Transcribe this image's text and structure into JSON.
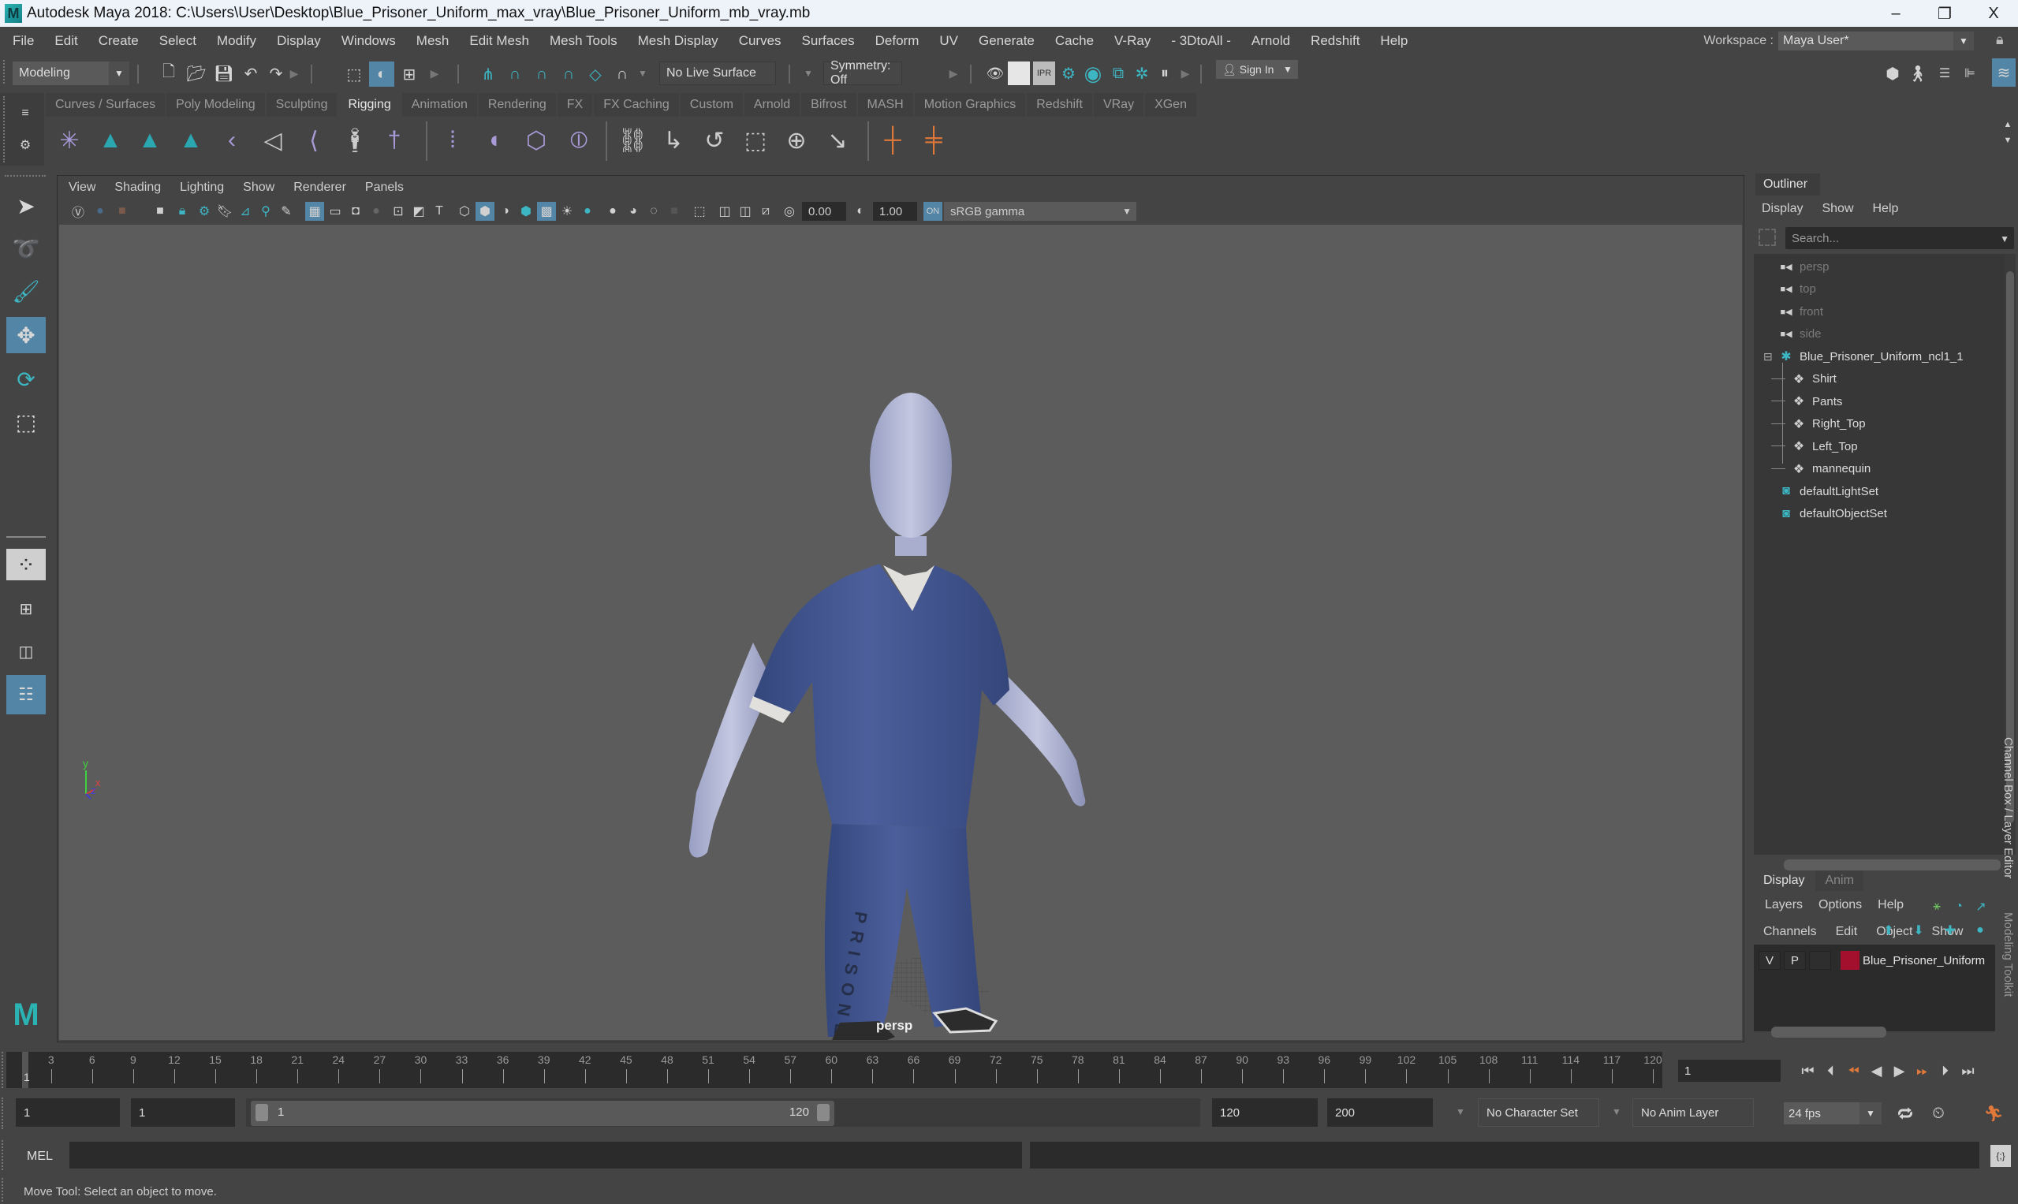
{
  "window": {
    "title": "Autodesk Maya 2018: C:\\Users\\User\\Desktop\\Blue_Prisoner_Uniform_max_vray\\Blue_Prisoner_Uniform_mb_vray.mb",
    "logo_letter": "M",
    "minimize": "–",
    "maximize": "❐",
    "close": "X"
  },
  "menubar": {
    "items": [
      "File",
      "Edit",
      "Create",
      "Select",
      "Modify",
      "Display",
      "Windows",
      "Mesh",
      "Edit Mesh",
      "Mesh Tools",
      "Mesh Display",
      "Curves",
      "Surfaces",
      "Deform",
      "UV",
      "Generate",
      "Cache",
      "V-Ray",
      "- 3DtoAll -",
      "Arnold",
      "Redshift",
      "Help"
    ],
    "workspace_label": "Workspace :",
    "workspace_value": "Maya User*"
  },
  "statusline": {
    "menuset": "Modeling",
    "live_surface": "No Live Surface",
    "symmetry": "Symmetry: Off",
    "sign_in": "Sign In",
    "icons": [
      "new-scene-icon",
      "open-scene-icon",
      "save-scene-icon",
      "undo-icon",
      "redo-icon",
      "select-hierarchy-icon",
      "select-object-icon",
      "select-component-icon",
      "snap-grid-icon",
      "snap-curve-icon",
      "snap-point-icon",
      "snap-view-plane-icon",
      "snap-live-icon",
      "snap-make-live-icon",
      "render-view-icon",
      "render-frame-icon",
      "ipr-render-icon",
      "render-settings-icon",
      "hypershade-icon",
      "render-setup-icon",
      "light-editor-icon",
      "pause-icon"
    ]
  },
  "shelf": {
    "tabs": [
      "Curves / Surfaces",
      "Poly Modeling",
      "Sculpting",
      "Rigging",
      "Animation",
      "Rendering",
      "FX",
      "FX Caching",
      "Custom",
      "Arnold",
      "Bifrost",
      "MASH",
      "Motion Graphics",
      "Redshift",
      "VRay",
      "XGen"
    ],
    "active_tab": "Rigging",
    "icons": [
      "joint-tool-icon",
      "quick-rig-icon",
      "hik-character-icon",
      "hik-skeleton-icon",
      "ik-handle-icon",
      "ik-spline-icon",
      "create-curve-warp-icon",
      "humanik-icon",
      "humanik-definition-icon",
      "bind-skin-icon",
      "paint-weights-icon",
      "lattice-icon",
      "cluster-icon",
      "parent-constraint-icon",
      "point-constraint-icon",
      "orient-constraint-icon",
      "scale-constraint-icon",
      "aim-constraint-icon",
      "pole-vector-constraint-icon",
      "locator-icon",
      "locator-constraint-icon"
    ]
  },
  "toolbox": {
    "tools": [
      "select-tool-icon",
      "lasso-tool-icon",
      "paint-select-tool-icon",
      "move-tool-icon",
      "rotate-tool-icon",
      "scale-tool-icon"
    ],
    "active_tool": "move-tool-icon",
    "layouts": [
      "single-perspective-layout-icon",
      "four-view-layout-icon",
      "two-view-layout-icon",
      "outliner-persp-layout-icon"
    ]
  },
  "viewport": {
    "menu": [
      "View",
      "Shading",
      "Lighting",
      "Show",
      "Renderer",
      "Panels"
    ],
    "exposure": "0.00",
    "gamma": "1.00",
    "color_space": "sRGB gamma",
    "camera_label": "persp",
    "pants_text": "PRISONER",
    "axis": {
      "y": "y",
      "x": "x",
      "z": "z"
    }
  },
  "outliner": {
    "tab": "Outliner",
    "menu": [
      "Display",
      "Show",
      "Help"
    ],
    "search_placeholder": "Search...",
    "items": [
      {
        "label": "persp",
        "type": "camera",
        "indent": 1
      },
      {
        "label": "top",
        "type": "camera",
        "indent": 1
      },
      {
        "label": "front",
        "type": "camera",
        "indent": 1
      },
      {
        "label": "side",
        "type": "camera",
        "indent": 1
      },
      {
        "label": "Blue_Prisoner_Uniform_ncl1_1",
        "type": "group",
        "indent": 1,
        "expanded": true
      },
      {
        "label": "Shirt",
        "type": "mesh",
        "indent": 2
      },
      {
        "label": "Pants",
        "type": "mesh",
        "indent": 2
      },
      {
        "label": "Right_Top",
        "type": "mesh",
        "indent": 2
      },
      {
        "label": "Left_Top",
        "type": "mesh",
        "indent": 2
      },
      {
        "label": "mannequin",
        "type": "mesh",
        "indent": 2
      },
      {
        "label": "defaultLightSet",
        "type": "set",
        "indent": 1
      },
      {
        "label": "defaultObjectSet",
        "type": "set",
        "indent": 1
      }
    ]
  },
  "channel_box": {
    "menu": [
      "Channels",
      "Edit",
      "Object",
      "Show"
    ],
    "side_tabs": [
      "Channel Box / Layer Editor",
      "Modeling Toolkit"
    ]
  },
  "layer_editor": {
    "tabs": [
      "Display",
      "Anim"
    ],
    "active_tab": "Display",
    "menu": [
      "Layers",
      "Options",
      "Help"
    ],
    "layers": [
      {
        "visible": "V",
        "playback": "P",
        "type": "",
        "color": "#a3102e",
        "name": "Blue_Prisoner_Uniform"
      }
    ]
  },
  "timeline": {
    "ticks": [
      3,
      6,
      9,
      12,
      15,
      18,
      21,
      24,
      27,
      30,
      33,
      36,
      39,
      42,
      45,
      48,
      51,
      54,
      57,
      60,
      63,
      66,
      69,
      72,
      75,
      78,
      81,
      84,
      87,
      90,
      93,
      96,
      99,
      102,
      105,
      108,
      111,
      114,
      117,
      120
    ],
    "start": 1,
    "end": 120,
    "current_frame": "1",
    "current_frame_field": "1"
  },
  "range": {
    "start_time": "1",
    "playback_start": "1",
    "range_start_label": "1",
    "range_end_label": "120",
    "playback_end": "120",
    "end_time": "200",
    "character_set": "No Character Set",
    "anim_layer": "No Anim Layer",
    "fps": "24 fps"
  },
  "command_line": {
    "language": "MEL",
    "input": "",
    "output": ""
  },
  "help_line": "Move Tool: Select an object to move.",
  "colors": {
    "accent": "#5285a6",
    "teal": "#3db6c4",
    "rig_purple": "#a99ad8",
    "orange": "#e0783a",
    "uniform_blue": "#42568f",
    "mannequin": "#b3b8d6"
  }
}
